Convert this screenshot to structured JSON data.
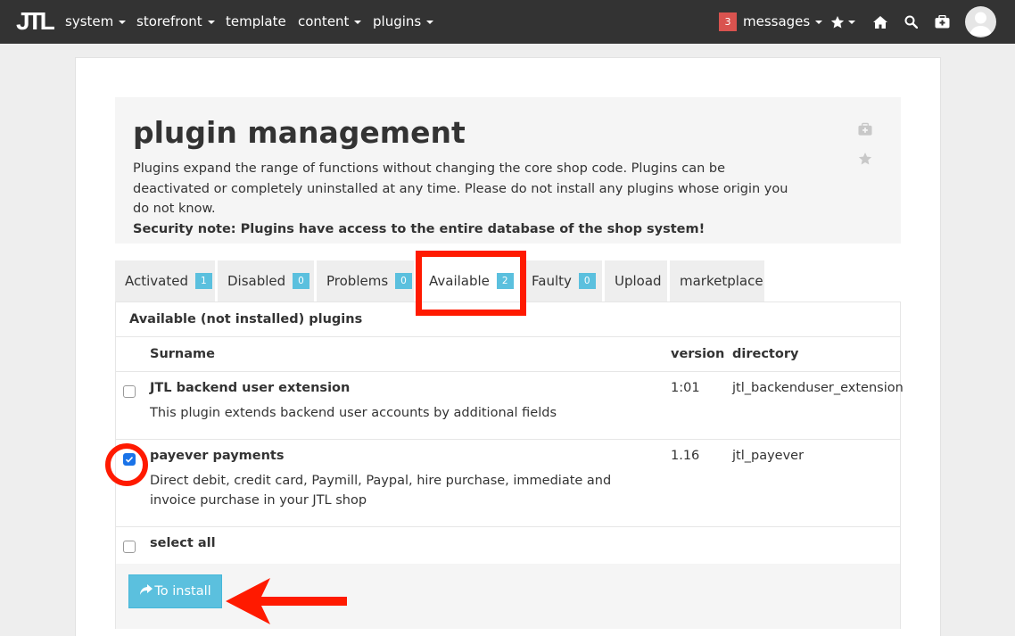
{
  "navbar": {
    "logo": "JTL",
    "menu": [
      {
        "label": "system",
        "dropdown": true
      },
      {
        "label": "storefront",
        "dropdown": true
      },
      {
        "label": "template",
        "dropdown": false
      },
      {
        "label": "content",
        "dropdown": true
      },
      {
        "label": "plugins",
        "dropdown": true
      }
    ],
    "messages_count": "3",
    "messages_label": "messages",
    "icons": [
      "star-icon",
      "home-icon",
      "search-icon",
      "medkit-icon"
    ],
    "avatar": "user-avatar"
  },
  "page": {
    "title": "plugin management",
    "description": "Plugins expand the range of functions without changing the core shop code. Plugins can be deactivated or completely uninstalled at any time. Please do not install any plugins whose origin you do not know.",
    "security_note": "Security note: Plugins have access to the entire database of the shop system!"
  },
  "tabs": [
    {
      "label": "Activated",
      "count": "1"
    },
    {
      "label": "Disabled",
      "count": "0"
    },
    {
      "label": "Problems",
      "count": "0"
    },
    {
      "label": "Available",
      "count": "2",
      "active": true
    },
    {
      "label": "Faulty",
      "count": "0"
    },
    {
      "label": "Upload"
    },
    {
      "label": "marketplace"
    }
  ],
  "panel": {
    "heading": "Available (not installed) plugins",
    "columns": {
      "name": "Surname",
      "version": "version",
      "directory": "directory"
    },
    "plugins": [
      {
        "name": "JTL backend user extension",
        "description": "This plugin extends backend user accounts by additional fields",
        "version": "1:01",
        "directory": "jtl_backenduser_extension",
        "checked": false
      },
      {
        "name": "payever payments",
        "description": "Direct debit, credit card, Paymill, Paypal, hire purchase, immediate and invoice purchase in your JTL shop",
        "version": "1.16",
        "directory": "jtl_payever",
        "checked": true
      }
    ],
    "select_all": "select all",
    "install_button": "To install"
  },
  "colors": {
    "navbar": "#333333",
    "badge": "#5bc0de",
    "message_badge": "#d9534f",
    "annotation": "#ff1a00"
  }
}
